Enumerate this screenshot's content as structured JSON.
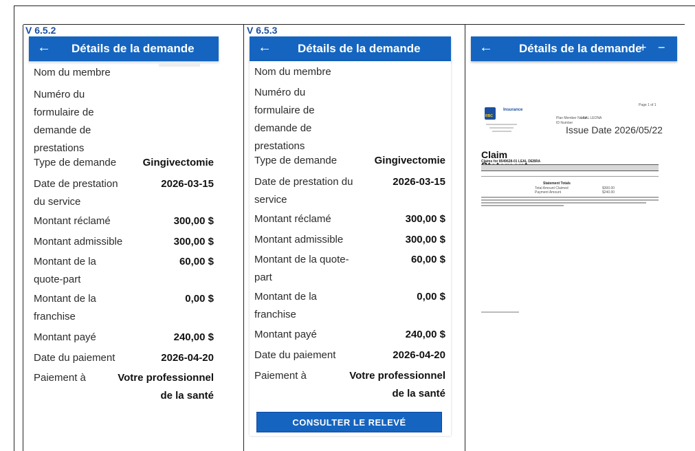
{
  "versions": {
    "v1": "V 6.5.2",
    "v2": "V 6.5.3"
  },
  "app": {
    "title": "Détails de la demande",
    "back_icon": "←",
    "zoom_in": "+",
    "zoom_out": "−"
  },
  "colors": {
    "appbar": "#1565c0",
    "version_label": "#1b4fa0"
  },
  "panel1": {
    "rows": [
      {
        "label": "Nom du membre",
        "value": ""
      },
      {
        "label": "Numéro du formulaire de demande de prestations",
        "value": ""
      },
      {
        "label": "Type de demande",
        "value": "Gingivectomie"
      },
      {
        "label": "Date de prestation du service",
        "value": "2026-03-15"
      },
      {
        "label": "Montant réclamé",
        "value": "300,00 $"
      },
      {
        "label": "Montant admissible",
        "value": "300,00 $"
      },
      {
        "label": "Montant de la quote-part",
        "value": "60,00 $"
      },
      {
        "label": "Montant de la franchise",
        "value": "0,00 $"
      },
      {
        "label": "Montant payé",
        "value": "240,00 $"
      },
      {
        "label": "Date du paiement",
        "value": "2026-04-20"
      },
      {
        "label": "Paiement à",
        "value": "Votre professionnel de la santé"
      }
    ]
  },
  "panel2": {
    "rows": [
      {
        "label": "Nom du membre",
        "value": ""
      },
      {
        "label": "Numéro du formulaire de demande de prestations",
        "value": ""
      },
      {
        "label": "Type de demande",
        "value": "Gingivectomie"
      },
      {
        "label": "Date de prestation du service",
        "value": "2026-03-15"
      },
      {
        "label": "Montant réclamé",
        "value": "300,00 $"
      },
      {
        "label": "Montant admissible",
        "value": "300,00 $"
      },
      {
        "label": "Montant de la quote-part",
        "value": "60,00 $"
      },
      {
        "label": "Montant de la franchise",
        "value": "0,00 $"
      },
      {
        "label": "Montant payé",
        "value": "240,00 $"
      },
      {
        "label": "Date du paiement",
        "value": "2026-04-20"
      },
      {
        "label": "Paiement à",
        "value": "Votre professionnel de la santé"
      }
    ],
    "button": "CONSULTER LE RELEVÉ"
  },
  "statement": {
    "brand": "Insurance",
    "logo_text": "RBC",
    "page": "Page 1 of 1",
    "plan_member_label": "Plan Member Name",
    "plan_member_value": "LEAL LEONA",
    "id_label": "ID Number",
    "issue_date_label": "Issue Date",
    "issue_date_value": "2026/05/22",
    "title": "Claim Statement",
    "claims_for": "Claims for 8549628-01 LEAL DEBRA",
    "table_headers": [
      "Patient Number",
      "Service Date",
      "Proc.DIN",
      "Claim Description",
      "Claimed",
      "Eligible",
      "Deductible",
      "Copay",
      "Paid"
    ],
    "table_row": [
      "15600963",
      "2026/03/15",
      "42621",
      "GINGIVECTOMY COMPLICATED",
      "300.00",
      "300.00",
      "0.00",
      "60.00",
      "240.00"
    ],
    "totals_title": "Statement Totals",
    "total_claimed_label": "Total Amount Claimed",
    "total_claimed_value": "$300.00",
    "payment_label": "Payment Amount",
    "payment_value": "$240.00"
  }
}
